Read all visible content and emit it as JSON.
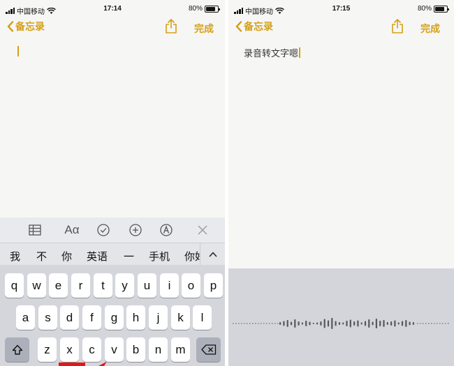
{
  "colors": {
    "accent": "#d4a017",
    "keyboard_bg": "#d4d6dc",
    "dictation_bg": "#d3d5db"
  },
  "screen1": {
    "status": {
      "carrier": "中国移动",
      "time": "17:14",
      "battery": "80%",
      "battery_level": 0.8
    },
    "nav": {
      "back_label": "备忘录",
      "done_label": "完成",
      "back_icon": "chevron-left-icon",
      "share_icon": "share-icon"
    },
    "note_text": "",
    "toolbar_icons": [
      "table-icon",
      "text-format-icon",
      "checklist-icon",
      "add-icon",
      "markup-icon",
      "close-icon"
    ],
    "toolbar_format_label": "Aα",
    "candidates": [
      "我",
      "不",
      "你",
      "英语",
      "一",
      "手机",
      "你好"
    ],
    "keyboard_rows": [
      [
        "q",
        "w",
        "e",
        "r",
        "t",
        "y",
        "u",
        "i",
        "o",
        "p"
      ],
      [
        "a",
        "s",
        "d",
        "f",
        "g",
        "h",
        "j",
        "k",
        "l"
      ],
      [
        "z",
        "x",
        "c",
        "v",
        "b",
        "n",
        "m"
      ]
    ]
  },
  "screen2": {
    "status": {
      "carrier": "中国移动",
      "time": "17:15",
      "battery": "80%",
      "battery_level": 0.8
    },
    "nav": {
      "back_label": "备忘录",
      "done_label": "完成",
      "back_icon": "chevron-left-icon",
      "share_icon": "share-icon"
    },
    "note_text": "录音转文字嗯",
    "dictation": {
      "icon": "waveform-icon"
    }
  }
}
